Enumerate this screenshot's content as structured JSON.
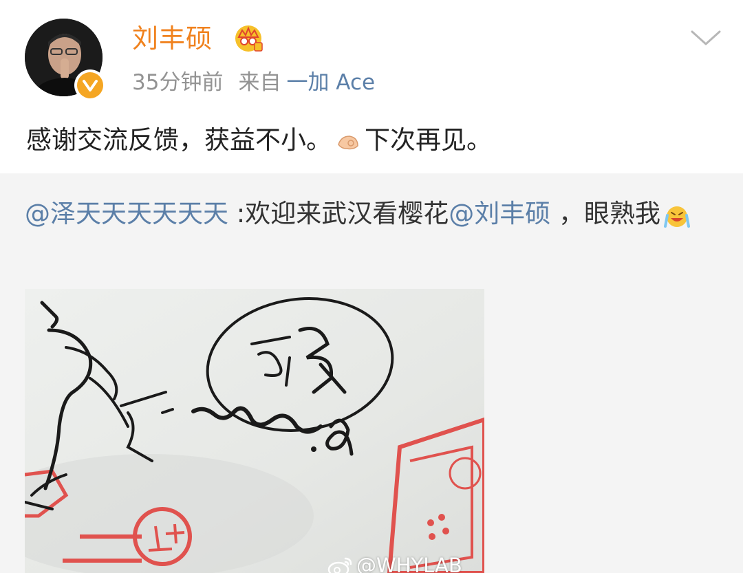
{
  "post": {
    "username": "刘丰硕",
    "time": "35分钟前",
    "from_label": "来自",
    "source": "一加 Ace",
    "text_part1": "感谢交流反馈，获益不小。",
    "text_part2": "下次再见。",
    "icons": {
      "avatar": "avatar-photo",
      "verified": "verified-badge-icon",
      "vip": "vip-crown-icon",
      "emoji": "ok-hand-emoji",
      "menu": "chevron-down-icon"
    }
  },
  "repost": {
    "mention1": "@泽天天天天天天",
    "text1": " :欢迎来武汉看樱花",
    "mention2": "@刘丰硕",
    "text2": " ，眼熟我",
    "emoji": "laughing-crying-emoji"
  },
  "image": {
    "subject": "signature-on-paper",
    "watermark": "@WHYLAB"
  },
  "colors": {
    "username": "#f0821e",
    "link": "#5b7fa8",
    "meta": "#939393",
    "verified": "#f5a623",
    "background": "#f4f4f4"
  }
}
